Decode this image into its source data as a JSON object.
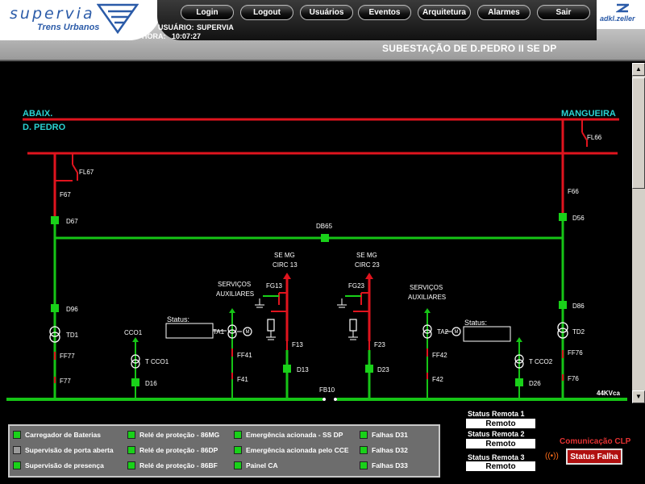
{
  "header": {
    "logo_main": "supervia",
    "logo_sub": "Trens Urbanos",
    "nav": [
      "Login",
      "Logout",
      "Usuários",
      "Eventos",
      "Arquitetura",
      "Alarmes",
      "Sair"
    ],
    "user_label": "USUÁRIO:",
    "user_value": "SUPERVIA",
    "time_label": "HORA:",
    "time_value": "10:07:27",
    "brand_right": "adkl.zeller",
    "station_title": "SUBESTAÇÃO DE D.PEDRO II SE DP"
  },
  "diagram": {
    "label_abaix": "ABAIX.",
    "label_dpedro": "D. PEDRO",
    "label_mangueira": "MANGUEIRA",
    "fl66": "FL66",
    "fl67": "FL67",
    "f67": "F67",
    "f66": "F66",
    "d67": "D67",
    "d56": "D56",
    "db65": "DB65",
    "d96": "D96",
    "d86": "D86",
    "td1": "TD1",
    "td2": "TD2",
    "ff77": "FF77",
    "ff76": "FF76",
    "f77": "F77",
    "f76": "F76",
    "cco1": "CCO1",
    "t_cco1": "T  CCO1",
    "d16": "D16",
    "cco2": "T  CCO2",
    "d26": "D26",
    "serv1_a": "SERVIÇOS",
    "serv1_b": "AUXILIARES",
    "serv2_a": "SERVIÇOS",
    "serv2_b": "AUXILIARES",
    "status1": "Status:",
    "status2": "Status:",
    "ta1": "TA1",
    "ta2": "TA2",
    "ff41": "FF41",
    "f41": "F41",
    "ff42": "FF42",
    "f42": "F42",
    "se1_a": "SE  MG",
    "se1_b": "CIRC  13",
    "se2_a": "SE  MG",
    "se2_b": "CIRC  23",
    "fg13": "FG13",
    "fg23": "FG23",
    "f13": "F13",
    "f23": "F23",
    "d13": "D13",
    "d23": "D23",
    "fb10": "FB10",
    "voltage": "44KVca",
    "motor": "M"
  },
  "status": {
    "items": [
      {
        "label": "Carregador de Baterias",
        "color": "#19d119"
      },
      {
        "label": "Supervisão de porta aberta",
        "color": "#9a9a9a"
      },
      {
        "label": "Supervisão de presença",
        "color": "#19d119"
      },
      {
        "label": "Relé de proteção - 86MG",
        "color": "#19d119"
      },
      {
        "label": "Relé de proteção - 86DP",
        "color": "#19d119"
      },
      {
        "label": "Relé de proteção - 86BF",
        "color": "#19d119"
      },
      {
        "label": "Emergência acionada - SS DP",
        "color": "#19d119"
      },
      {
        "label": "Emergência acionada pelo CCE",
        "color": "#19d119"
      },
      {
        "label": "Painel CA",
        "color": "#19d119"
      },
      {
        "label": "Falhas D31",
        "color": "#19d119"
      },
      {
        "label": "Falhas D32",
        "color": "#19d119"
      },
      {
        "label": "Falhas D33",
        "color": "#19d119"
      }
    ]
  },
  "remotes": [
    {
      "label": "Status Remota 1",
      "value": "Remoto"
    },
    {
      "label": "Status Remota 2",
      "value": "Remoto"
    },
    {
      "label": "Status Remota 3",
      "value": "Remoto"
    }
  ],
  "clp": {
    "label": "Comunicação CLP",
    "button": "Status Falha"
  },
  "colors": {
    "energized": "#e0141e",
    "green_line": "#16c416",
    "breaker": "#19d119"
  }
}
